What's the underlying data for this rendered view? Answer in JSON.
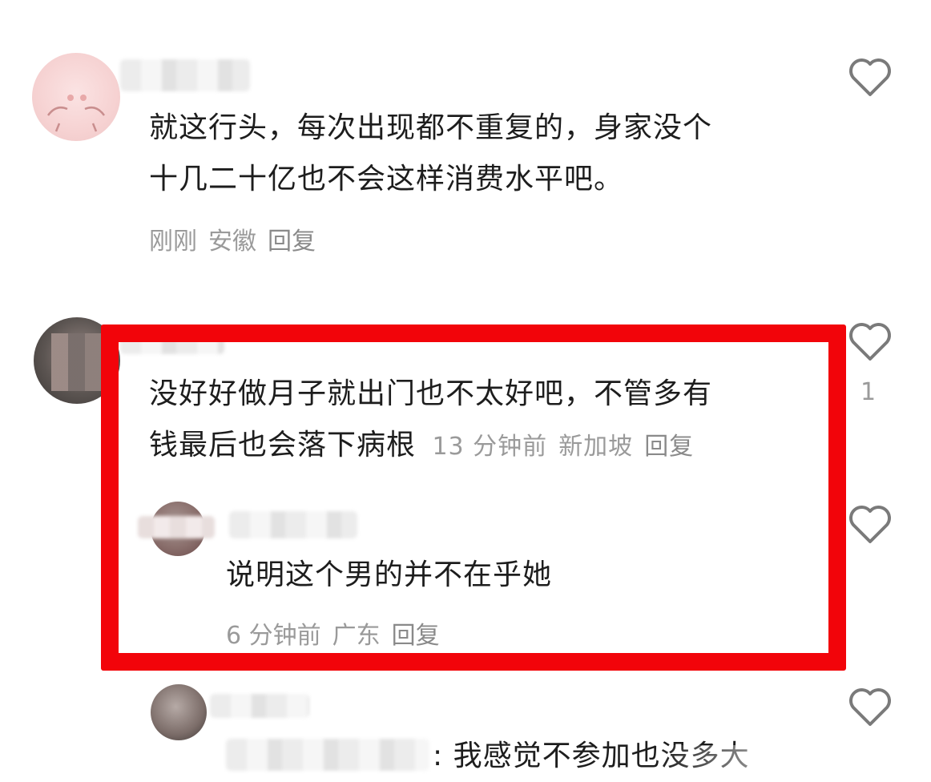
{
  "comments": [
    {
      "text_line1": "就这行头，每次出现都不重复的，身家没个",
      "text_line2": "十几二十亿也不会这样消费水平吧。",
      "time": "刚刚",
      "location": "安徽",
      "reply_label": "回复",
      "like_count": ""
    },
    {
      "text_line1": "没好好做月子就出门也不太好吧，不管多有",
      "text_line2": "钱最后也会落下病根",
      "time": "13 分钟前",
      "location": "新加坡",
      "reply_label": "回复",
      "like_count": "1",
      "highlight_color": "#f2040a"
    }
  ],
  "replies": [
    {
      "text": "说明这个男的并不在乎她",
      "time": "6 分钟前",
      "location": "广东",
      "reply_label": "回复"
    },
    {
      "name_suffix": "…",
      "text": "我感觉不参加也没多大"
    }
  ],
  "icons": {
    "like": "heart-outline-icon"
  }
}
